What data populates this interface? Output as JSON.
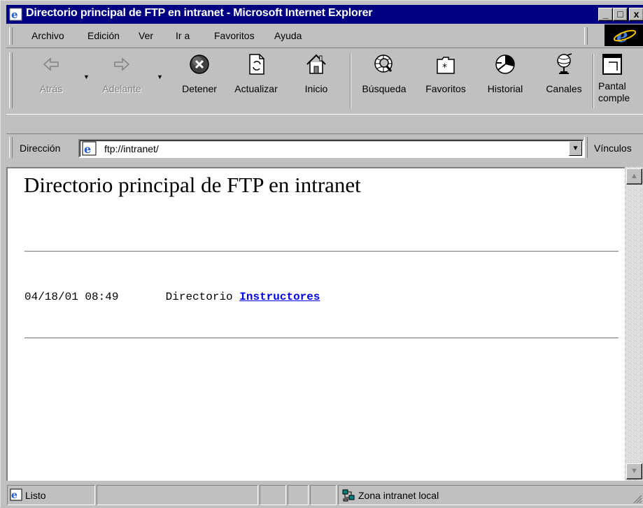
{
  "window": {
    "title": "Directorio principal de FTP en intranet - Microsoft Internet Explorer",
    "controls": {
      "minimize": "_",
      "maximize": "□",
      "close": "x"
    }
  },
  "menu": [
    "Archivo",
    "Edición",
    "Ver",
    "Ir a",
    "Favoritos",
    "Ayuda"
  ],
  "toolbar": {
    "back": "Atrás",
    "forward": "Adelante",
    "stop": "Detener",
    "refresh": "Actualizar",
    "home": "Inicio",
    "search": "Búsqueda",
    "favorites": "Favoritos",
    "history": "Historial",
    "channels": "Canales",
    "fullscreen_line1": "Pantal",
    "fullscreen_line2": "comple"
  },
  "address": {
    "label": "Dirección",
    "url": "ftp://intranet/",
    "links_label": "Vínculos"
  },
  "page": {
    "heading": "Directorio principal de FTP en intranet",
    "entries": [
      {
        "date": "04/18/01 08:49",
        "type": "Directorio",
        "name": "Instructores"
      }
    ]
  },
  "status": {
    "text": "Listo",
    "zone": "Zona intranet local"
  },
  "colors": {
    "titlebar": "#000080",
    "chrome": "#c0c0c0",
    "link": "#0000ee"
  },
  "icons": [
    "ie-page-icon",
    "back-arrow-icon",
    "forward-arrow-icon",
    "stop-icon",
    "refresh-icon",
    "home-icon",
    "search-icon",
    "favorites-icon",
    "history-icon",
    "channels-icon",
    "fullscreen-icon",
    "ie-logo-icon",
    "zone-icon"
  ]
}
